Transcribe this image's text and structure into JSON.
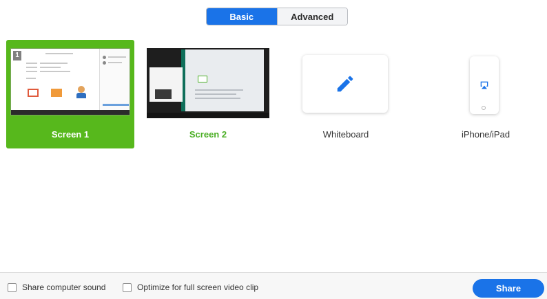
{
  "tabs": {
    "basic_label": "Basic",
    "advanced_label": "Advanced",
    "active": "Basic"
  },
  "options": [
    {
      "id": "screen1",
      "label": "Screen 1",
      "selected": true,
      "badge": "1",
      "icon": "screen-thumbnail"
    },
    {
      "id": "screen2",
      "label": "Screen 2",
      "selected": false,
      "icon": "screen-thumbnail"
    },
    {
      "id": "whiteboard",
      "label": "Whiteboard",
      "selected": false,
      "icon": "pencil-icon"
    },
    {
      "id": "iphone",
      "label": "iPhone/iPad",
      "selected": false,
      "icon": "airplay-icon"
    }
  ],
  "footer": {
    "share_sound_label": "Share computer sound",
    "optimize_label": "Optimize for full screen video clip",
    "share_sound_checked": false,
    "optimize_checked": false,
    "share_button_label": "Share"
  },
  "colors": {
    "accent_blue": "#1a73e8",
    "selected_green": "#57b81c",
    "screen2_label_green": "#4caf26"
  }
}
